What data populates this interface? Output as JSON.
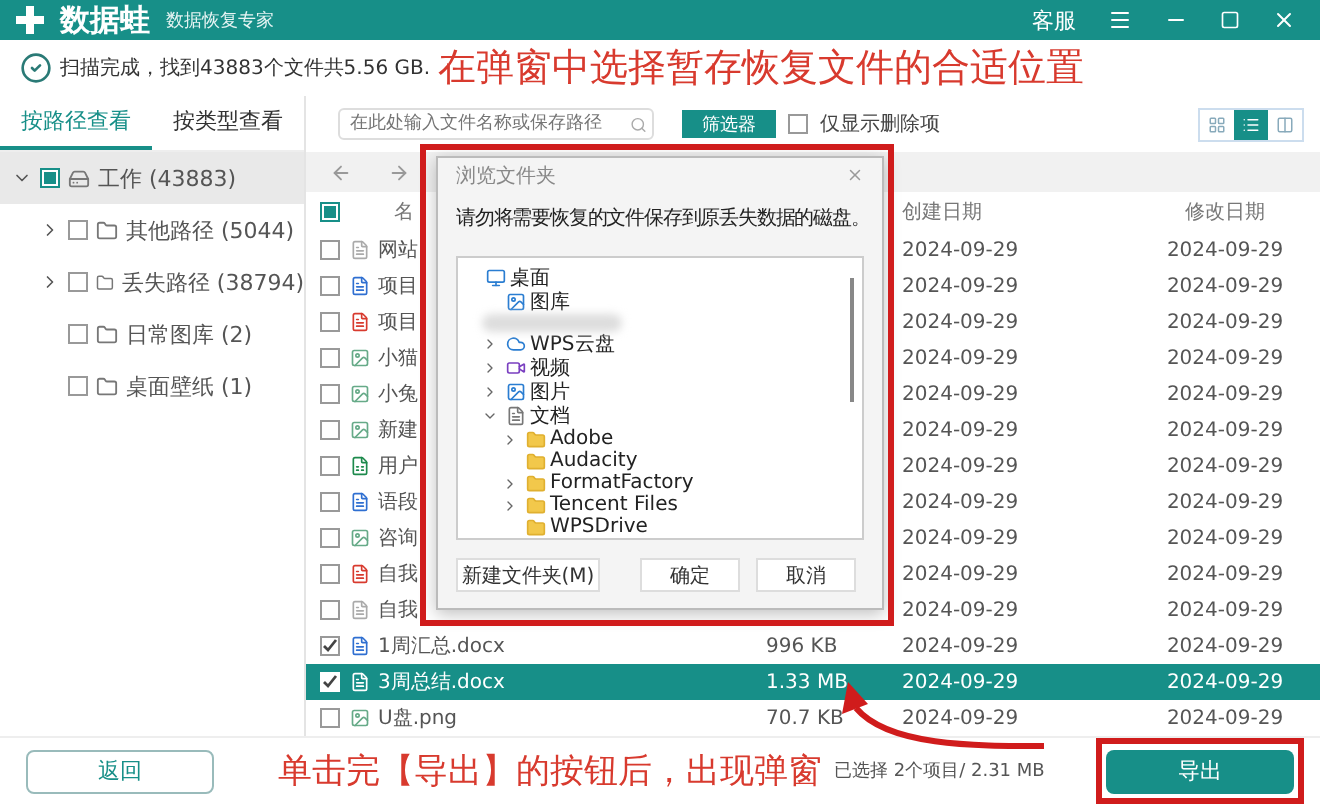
{
  "app": {
    "logo": "数据蛙",
    "subtitle": "数据恢复专家",
    "support": "客服"
  },
  "scan": {
    "status": "扫描完成，找到43883个文件共5.56 GB."
  },
  "annotations": {
    "top": "在弹窗中选择暂存恢复文件的合适位置",
    "bottom": "单击完【导出】的按钮后，出现弹窗"
  },
  "sidebar": {
    "tabs": [
      {
        "label": "按路径查看",
        "selected": true
      },
      {
        "label": "按类型查看",
        "selected": false
      }
    ],
    "tree": [
      {
        "label": "工作 (43883)",
        "kind": "drive",
        "checked": false,
        "partial": true,
        "expanded": true,
        "selected": true,
        "children": [
          {
            "label": "其他路径 (5044)",
            "kind": "folder",
            "checked": false,
            "partial": false,
            "expanded": false,
            "selected": false
          },
          {
            "label": "丢失路径 (38794)",
            "kind": "folder",
            "checked": false,
            "partial": false,
            "expanded": false,
            "selected": false
          },
          {
            "label": "日常图库 (2)",
            "kind": "folder",
            "checked": false,
            "partial": false,
            "selected": false
          },
          {
            "label": "桌面壁纸 (1)",
            "kind": "folder",
            "checked": false,
            "partial": false,
            "selected": false
          }
        ]
      }
    ]
  },
  "toolbar": {
    "search": {
      "placeholder": "在此处输入文件名称或保存路径"
    },
    "filter": "筛选器",
    "deleted_only": {
      "label": "仅显示删除项",
      "checked": false
    },
    "views": [
      {
        "kind": "grid",
        "selected": false
      },
      {
        "kind": "list",
        "selected": true
      },
      {
        "kind": "columns",
        "selected": false
      }
    ]
  },
  "table": {
    "header_checkbox": {
      "checked": false,
      "partial": true
    },
    "columns": [
      "名",
      "创建日期",
      "修改日期"
    ],
    "rows": [
      {
        "name": "网站",
        "kind": "text",
        "checked": false,
        "selected": false,
        "created": "2024-09-29",
        "modified": "2024-09-29"
      },
      {
        "name": "项目",
        "kind": "word",
        "checked": false,
        "selected": false,
        "created": "2024-09-29",
        "modified": "2024-09-29"
      },
      {
        "name": "项目",
        "kind": "pdf",
        "checked": false,
        "selected": false,
        "created": "2024-09-29",
        "modified": "2024-09-29"
      },
      {
        "name": "小猫",
        "kind": "image",
        "checked": false,
        "selected": false,
        "created": "2024-09-29",
        "modified": "2024-09-29"
      },
      {
        "name": "小兔",
        "kind": "image",
        "checked": false,
        "selected": false,
        "created": "2024-09-29",
        "modified": "2024-09-29"
      },
      {
        "name": "新建",
        "kind": "image",
        "checked": false,
        "selected": false,
        "created": "2024-09-29",
        "modified": "2024-09-29"
      },
      {
        "name": "用户",
        "kind": "sheet",
        "checked": false,
        "selected": false,
        "created": "2024-09-29",
        "modified": "2024-09-29"
      },
      {
        "name": "语段",
        "kind": "word",
        "checked": false,
        "selected": false,
        "created": "2024-09-29",
        "modified": "2024-09-29"
      },
      {
        "name": "咨询",
        "kind": "image",
        "checked": false,
        "selected": false,
        "created": "2024-09-29",
        "modified": "2024-09-29"
      },
      {
        "name": "自我",
        "kind": "pdf",
        "checked": false,
        "selected": false,
        "created": "2024-09-29",
        "modified": "2024-09-29"
      },
      {
        "name": "自我",
        "kind": "text",
        "checked": false,
        "selected": false,
        "created": "2024-09-29",
        "modified": "2024-09-29"
      },
      {
        "name": "1周汇总.docx",
        "kind": "word",
        "checked": true,
        "selected": false,
        "size": "996 KB",
        "created": "2024-09-29",
        "modified": "2024-09-29"
      },
      {
        "name": "3周总结.docx",
        "kind": "word",
        "checked": true,
        "selected": true,
        "size": "1.33 MB",
        "created": "2024-09-29",
        "modified": "2024-09-29"
      },
      {
        "name": "U盘.png",
        "kind": "image",
        "checked": false,
        "selected": false,
        "size": "70.7 KB",
        "created": "2024-09-29",
        "modified": "2024-09-29"
      }
    ]
  },
  "dialog": {
    "title": "浏览文件夹",
    "message": "请勿将需要恢复的文件保存到原丢失数据的磁盘。",
    "tree": [
      {
        "label": "桌面",
        "kind": "desktop",
        "children": [
          {
            "label": "图库",
            "kind": "gallery"
          },
          {
            "kind": "blurred"
          },
          {
            "label": "WPS云盘",
            "kind": "cloud",
            "expanded": false
          },
          {
            "label": "视频",
            "kind": "video",
            "expanded": false
          },
          {
            "label": "图片",
            "kind": "picture",
            "expanded": false
          },
          {
            "label": "文档",
            "kind": "document",
            "expanded": true,
            "children": [
              {
                "label": "Adobe",
                "kind": "folder",
                "expanded": false
              },
              {
                "label": "Audacity",
                "kind": "folder"
              },
              {
                "label": "FormatFactory",
                "kind": "folder",
                "expanded": false
              },
              {
                "label": "Tencent Files",
                "kind": "folder",
                "expanded": false
              },
              {
                "label": "WPSDrive",
                "kind": "folder"
              }
            ]
          }
        ]
      }
    ],
    "buttons": [
      "新建文件夹(M)",
      "确定",
      "取消"
    ]
  },
  "footer": {
    "back": "返回",
    "selection": "已选择 2个项目/ 2.31 MB",
    "export": "导出"
  }
}
